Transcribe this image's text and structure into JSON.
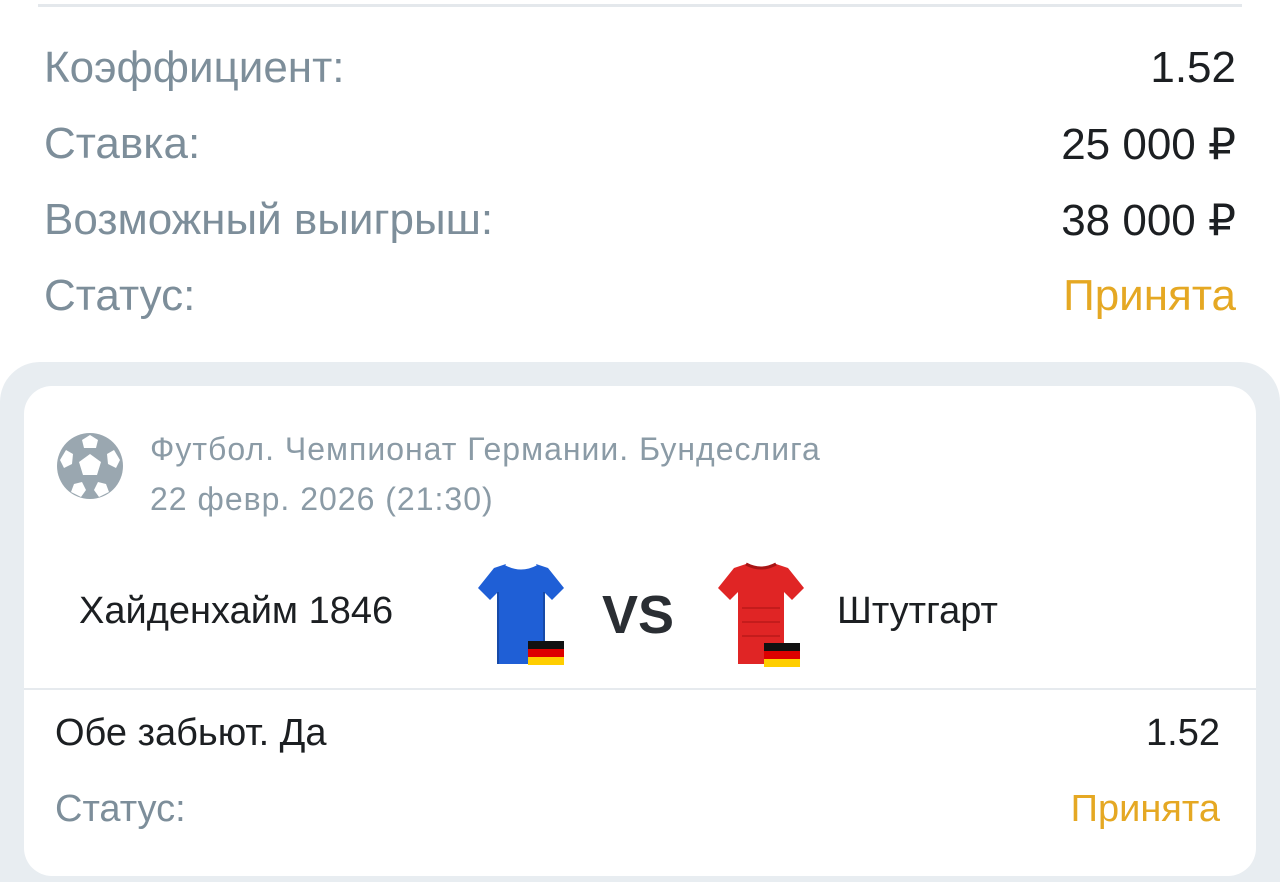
{
  "summary": {
    "coefficient_label": "Коэффициент:",
    "coefficient_value": "1.52",
    "stake_label": "Ставка:",
    "stake_value": "25 000 ₽",
    "payout_label": "Возможный выигрыш:",
    "payout_value": "38 000 ₽",
    "status_label": "Статус:",
    "status_value": "Принята"
  },
  "event": {
    "sport_icon": "soccer-ball-icon",
    "league": "Футбол. Чемпионат Германии. Бундеслига",
    "datetime": "22 февр. 2026 (21:30)",
    "home_team": "Хайденхайм 1846",
    "away_team": "Штутгарт",
    "vs": "VS",
    "home_jersey_icon": "blue-jersey-icon",
    "away_jersey_icon": "red-jersey-icon",
    "flag_icon": "germany-flag-icon"
  },
  "selection": {
    "market": "Обе забьют. Да",
    "odds": "1.52",
    "status_label": "Статус:",
    "status_value": "Принята"
  },
  "colors": {
    "label_gray": "#7d8e9a",
    "accent_status": "#e5a823",
    "panel_bg": "#e8edf1",
    "home_jersey": "#1f5fd6",
    "away_jersey": "#e02525"
  }
}
